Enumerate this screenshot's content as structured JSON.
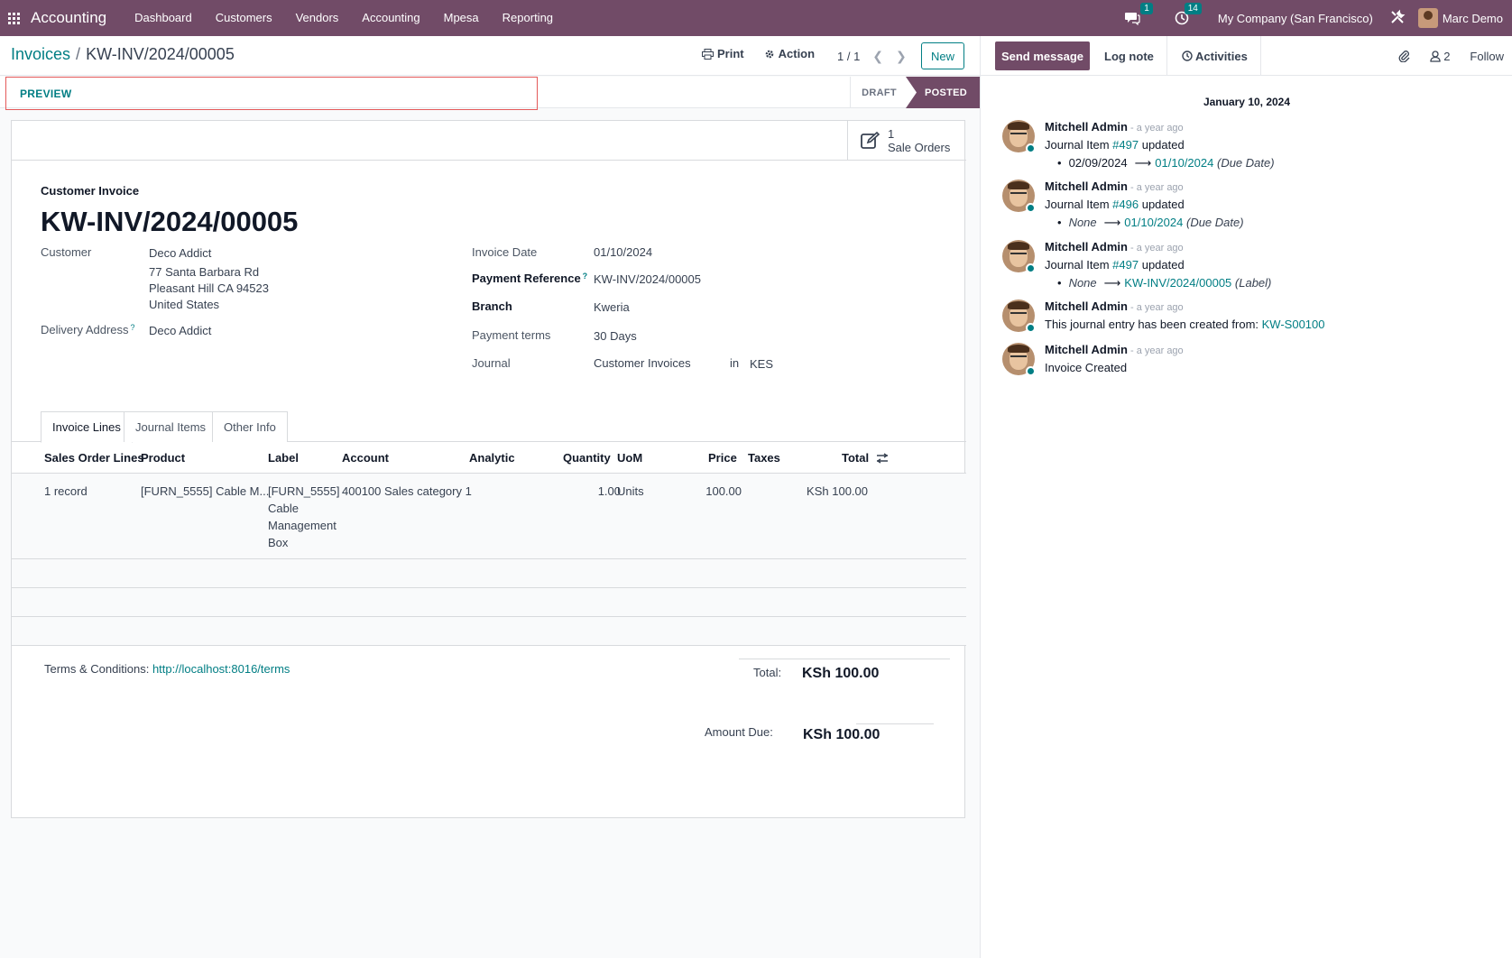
{
  "navbar": {
    "brand": "Accounting",
    "menu": [
      "Dashboard",
      "Customers",
      "Vendors",
      "Accounting",
      "Mpesa",
      "Reporting"
    ],
    "messages_count": "1",
    "activities_count": "14",
    "company": "My Company (San Francisco)",
    "user": "Marc Demo"
  },
  "control": {
    "breadcrumb_parent": "Invoices",
    "breadcrumb_sep": "/",
    "breadcrumb_current": "KW-INV/2024/00005",
    "print_label": "Print",
    "action_label": "Action",
    "pager": "1 / 1",
    "new_label": "New"
  },
  "statusbar": {
    "preview_label": "PREVIEW",
    "stages": [
      "DRAFT",
      "POSTED"
    ],
    "active_stage": "POSTED"
  },
  "smart_button": {
    "count": "1",
    "label": "Sale Orders"
  },
  "invoice": {
    "type": "Customer Invoice",
    "name": "KW-INV/2024/00005",
    "customer_label": "Customer",
    "customer": "Deco Addict",
    "address": [
      "77 Santa Barbara Rd",
      "Pleasant Hill CA 94523",
      "United States"
    ],
    "delivery_label": "Delivery Address",
    "delivery": "Deco Addict",
    "help_mark": "?",
    "invoice_date_label": "Invoice Date",
    "invoice_date": "01/10/2024",
    "payment_ref_label": "Payment Reference",
    "payment_ref": "KW-INV/2024/00005",
    "branch_label": "Branch",
    "branch": "Kweria",
    "payment_terms_label": "Payment terms",
    "payment_terms": "30 Days",
    "journal_label": "Journal",
    "journal": "Customer Invoices",
    "journal_in": "in",
    "currency": "KES"
  },
  "tabs": [
    "Invoice Lines",
    "Journal Items",
    "Other Info"
  ],
  "lines": {
    "headers": [
      "Sales Order Lines",
      "Product",
      "Label",
      "Account",
      "Analytic",
      "Quantity",
      "UoM",
      "Price",
      "Taxes",
      "Total"
    ],
    "rows": [
      {
        "so_lines": "1 record",
        "product": "[FURN_5555] Cable M...",
        "label": [
          "[FURN_5555]",
          "Cable",
          "Management",
          "Box"
        ],
        "account": "400100 Sales category 1",
        "analytic": "",
        "quantity": "1.00",
        "uom": "Units",
        "price": "100.00",
        "taxes": "",
        "total": "KSh 100.00"
      }
    ]
  },
  "footer": {
    "terms_label": "Terms & Conditions:",
    "terms_link": "http://localhost:8016/terms",
    "total_label": "Total:",
    "total": "KSh 100.00",
    "due_label": "Amount Due:",
    "due": "KSh 100.00"
  },
  "chatter": {
    "send_message": "Send message",
    "log_note": "Log note",
    "activities": "Activities",
    "followers_count": "2",
    "follow": "Follow",
    "date": "January 10, 2024",
    "messages": [
      {
        "author": "Mitchell Admin",
        "ago": "- a year ago",
        "prefix": "Journal Item",
        "ref": "#497",
        "suffix": "updated",
        "old": "02/09/2024",
        "old_italic": false,
        "new": "01/10/2024",
        "field": "(Due Date)"
      },
      {
        "author": "Mitchell Admin",
        "ago": "- a year ago",
        "prefix": "Journal Item",
        "ref": "#496",
        "suffix": "updated",
        "old": "None",
        "old_italic": true,
        "new": "01/10/2024",
        "field": "(Due Date)"
      },
      {
        "author": "Mitchell Admin",
        "ago": "- a year ago",
        "prefix": "Journal Item",
        "ref": "#497",
        "suffix": "updated",
        "old": "None",
        "old_italic": true,
        "new": "KW-INV/2024/00005",
        "field": "(Label)"
      },
      {
        "author": "Mitchell Admin",
        "ago": "- a year ago",
        "text": "This journal entry has been created from:",
        "link": "KW-S00100"
      },
      {
        "author": "Mitchell Admin",
        "ago": "- a year ago",
        "text": "Invoice Created"
      }
    ]
  },
  "colors": {
    "brand": "#714b67",
    "accent": "#017e84",
    "preview_outline": "#e45a5a"
  }
}
